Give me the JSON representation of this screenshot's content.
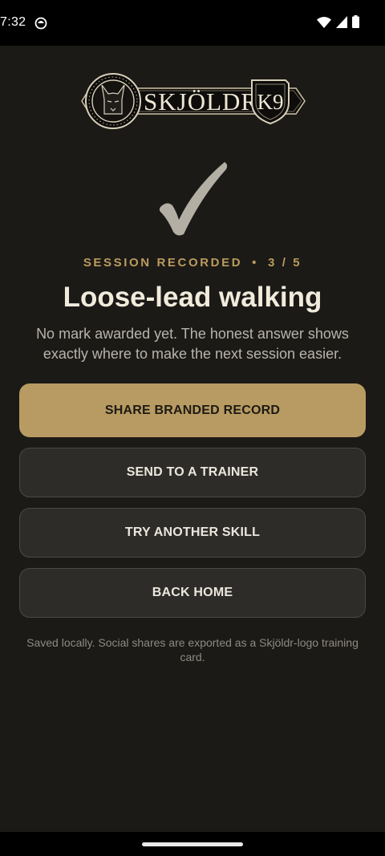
{
  "status_bar": {
    "time": "7:32",
    "icons": [
      "app-notification-icon",
      "wifi-icon",
      "cell-signal-icon",
      "battery-icon"
    ]
  },
  "brand": {
    "logo_text": "SKJÖLDR",
    "badge_text": "K9",
    "colors": {
      "gold": "#bb9a5e",
      "dark": "#1b1a17"
    }
  },
  "result": {
    "icon": "checkmark-icon",
    "session_label": "SESSION RECORDED",
    "separator": "•",
    "progress": "3 / 5",
    "title": "Loose-lead walking",
    "subtitle": "No mark awarded yet. The honest answer shows exactly where to make the next session easier."
  },
  "actions": {
    "share": "SHARE BRANDED RECORD",
    "send_trainer": "SEND TO A TRAINER",
    "try_another": "TRY ANOTHER SKILL",
    "back_home": "BACK HOME"
  },
  "footnote": "Saved locally. Social shares are exported as a Skjöldr-logo training card."
}
